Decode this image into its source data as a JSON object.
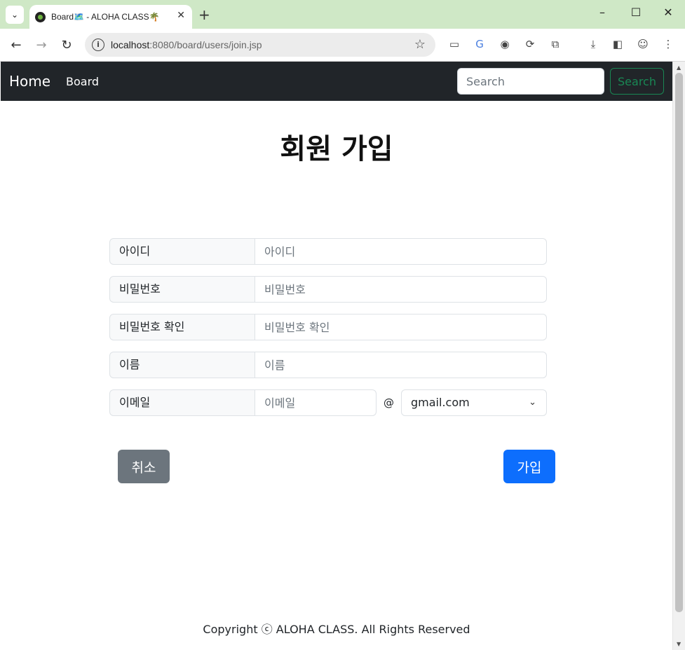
{
  "browser": {
    "tab_title": "Board🗺️ - ALOHA CLASS🌴",
    "tab_close": "✕",
    "new_tab": "+",
    "window_controls": [
      "–",
      "☐",
      "✕"
    ],
    "url_host": "localhost",
    "url_path": ":8080/board/users/join.jsp",
    "icons": [
      "back-icon",
      "forward-icon",
      "reload-icon",
      "site-info-icon",
      "bookmark-star-icon",
      "cast-icon",
      "translate-icon",
      "camera-icon",
      "sync-icon",
      "extensions-icon",
      "download-icon",
      "sidebar-icon",
      "profile-icon",
      "menu-icon"
    ]
  },
  "navbar": {
    "brand": "Home",
    "link": "Board",
    "search_placeholder": "Search",
    "search_button": "Search"
  },
  "page": {
    "title": "회원 가입"
  },
  "form": {
    "id_label": "아이디",
    "id_placeholder": "아이디",
    "pw_label": "비밀번호",
    "pw_placeholder": "비밀번호",
    "pw_confirm_label": "비밀번호 확인",
    "pw_confirm_placeholder": "비밀번호 확인",
    "name_label": "이름",
    "name_placeholder": "이름",
    "email_label": "이메일",
    "email_placeholder": "이메일",
    "at_sign": "@",
    "domain_selected": "gmail.com"
  },
  "buttons": {
    "cancel": "취소",
    "join": "가입"
  },
  "footer": {
    "text": "Copyright ⓒ ALOHA CLASS. All Rights Reserved"
  },
  "colors": {
    "navbar_bg": "#212529",
    "primary": "#0d6efd",
    "secondary": "#6c757d",
    "success": "#198754",
    "tabbar_bg": "#cfe8c6"
  }
}
